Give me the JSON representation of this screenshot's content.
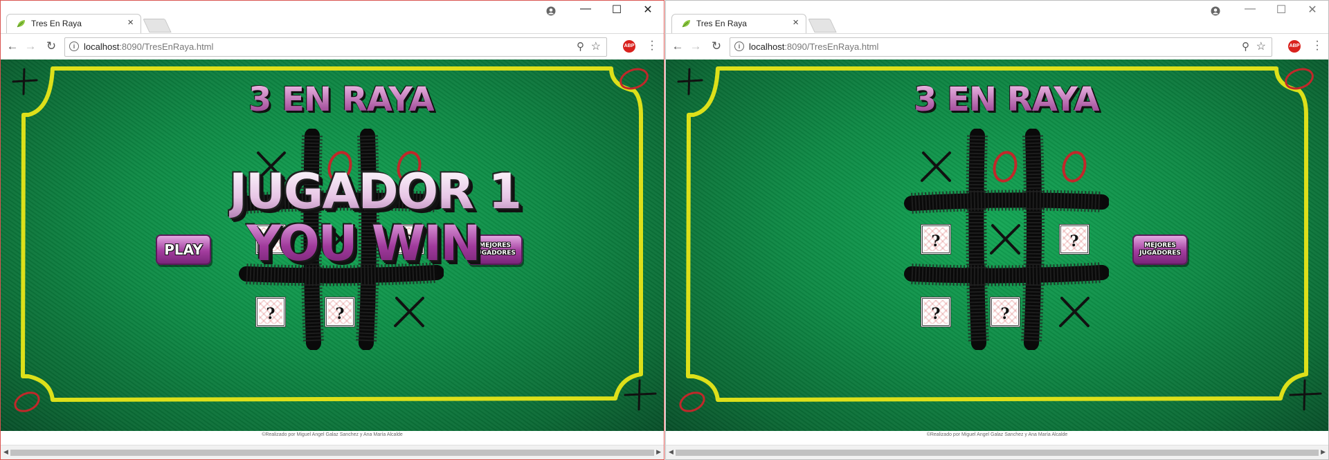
{
  "windows": [
    {
      "tab_title": "Tres En Raya",
      "url_host": "localhost",
      "url_rest": ":8090/TresEnRaya.html",
      "controls": {
        "minimize": "—",
        "maximize": "☐",
        "close": "✕"
      },
      "abp_label": "ABP",
      "game": {
        "title": "3 EN RAYA",
        "play_label": "PLAY",
        "best_label_1": "MEJORES",
        "best_label_2": "JUGADORES",
        "overlay_line1": "JUGADOR 1",
        "overlay_line2": "YOU WIN",
        "card_symbol": "?"
      },
      "footer": "©Realizado por Miguel Angel Galaz Sanchez y Ana María Alcalde"
    },
    {
      "tab_title": "Tres En Raya",
      "url_host": "localhost",
      "url_rest": ":8090/TresEnRaya.html",
      "controls": {
        "minimize": "—",
        "maximize": "☐",
        "close": "✕"
      },
      "abp_label": "ABP",
      "game": {
        "title": "3 EN RAYA",
        "best_label_1": "MEJORES",
        "best_label_2": "JUGADORES",
        "card_symbol": "?"
      },
      "footer": "©Realizado por Miguel Angel Galaz Sanchez y Ana María Alcalde"
    }
  ],
  "boards": [
    [
      "X",
      "O",
      "O",
      "?",
      "X",
      "?",
      "?",
      "?",
      "X"
    ],
    [
      "X",
      "O",
      "O",
      "?",
      "X",
      "?",
      "?",
      "?",
      "X"
    ]
  ],
  "colors": {
    "felt": "#0e8a45",
    "frame": "#dde01a",
    "accent": "#a33d9e",
    "o_mark": "#c0282a",
    "x_mark": "#111111"
  },
  "icons": [
    "user-icon",
    "back-icon",
    "forward-icon",
    "reload-icon",
    "info-icon",
    "zoom-icon",
    "star-icon",
    "adblock-icon",
    "menu-icon"
  ]
}
